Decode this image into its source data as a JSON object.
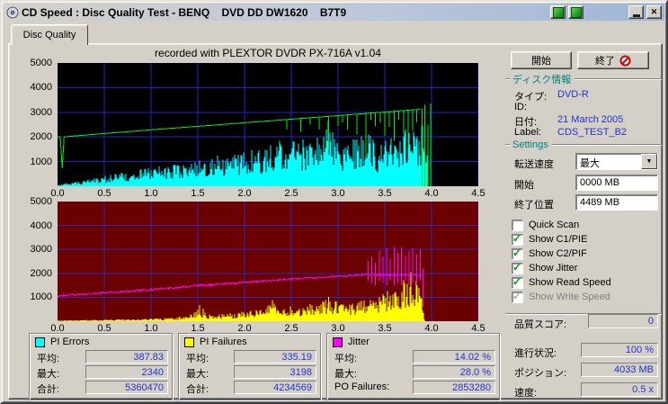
{
  "window": {
    "title": "CD Speed : Disc Quality Test - BENQ    DVD DD DW1620    B7T9"
  },
  "tab": {
    "label": "Disc Quality"
  },
  "recorded_note": "recorded with PLEXTOR DVDR   PX-716A   v1.04",
  "buttons": {
    "start": "開始",
    "exit": "終了"
  },
  "disc_info": {
    "header": "ディスク情報",
    "type_label": "タイプ:",
    "type_value": "DVD-R",
    "id_label": "ID:",
    "id_value": "",
    "date_label": "日付:",
    "date_value": "21 March 2005",
    "label_label": "Label:",
    "label_value": "CDS_TEST_B2"
  },
  "settings": {
    "header": "Settings",
    "speed_label": "転送速度",
    "speed_value": "最大",
    "start_label": "開始",
    "start_value": "0000 MB",
    "end_label": "終了位置",
    "end_value": "4489 MB",
    "checkboxes": [
      {
        "label": "Quick Scan",
        "checked": false,
        "disabled": false
      },
      {
        "label": "Show C1/PIE",
        "checked": true,
        "disabled": false
      },
      {
        "label": "Show C2/PIF",
        "checked": true,
        "disabled": false
      },
      {
        "label": "Show Jitter",
        "checked": true,
        "disabled": false
      },
      {
        "label": "Show Read Speed",
        "checked": true,
        "disabled": false
      },
      {
        "label": "Show Write Speed",
        "checked": true,
        "disabled": true
      }
    ]
  },
  "quality": {
    "label": "品質スコア:",
    "value": "0"
  },
  "progress": {
    "label": "進行状況:",
    "value": "100 %"
  },
  "position": {
    "label": "ポジション:",
    "value": "4033 MB"
  },
  "speed": {
    "label": "速度:",
    "value": "0.5 x"
  },
  "stat_panels": [
    {
      "title": "PI Errors",
      "color": "#00ffff",
      "rows": [
        {
          "label": "平均:",
          "value": "387.83"
        },
        {
          "label": "最大:",
          "value": "2340"
        },
        {
          "label": "合計:",
          "value": "5360470"
        }
      ]
    },
    {
      "title": "PI Failures",
      "color": "#ffff00",
      "rows": [
        {
          "label": "平均:",
          "value": "335.19"
        },
        {
          "label": "最大:",
          "value": "3198"
        },
        {
          "label": "合計:",
          "value": "4234569"
        }
      ]
    },
    {
      "title": "Jitter",
      "color": "#ff00ff",
      "rows": [
        {
          "label": "平均:",
          "value": "14.02 %"
        },
        {
          "label": "最大:",
          "value": "28.0 %"
        },
        {
          "label": "PO Failures:",
          "value": "2853280"
        }
      ]
    }
  ],
  "colors": {
    "face": "#d4d0c8",
    "value_text": "#2233cc",
    "section_header": "#008080"
  },
  "chart_data": [
    {
      "name": "pi-errors-read-speed-chart",
      "type": "area",
      "title": "",
      "xlabel": "",
      "ylabel": "",
      "xlim": [
        0,
        4.5
      ],
      "ylim": [
        0,
        5000
      ],
      "xticks": [
        "0.0",
        "0.5",
        "1.0",
        "1.5",
        "2.0",
        "2.5",
        "3.0",
        "3.5",
        "4.0",
        "4.5"
      ],
      "yticks": [
        1000,
        2000,
        3000,
        4000,
        5000
      ],
      "bg": "#000000",
      "grid_color": "#2222cc",
      "series": [
        {
          "name": "PI Errors",
          "type": "spikes",
          "color": "#00ffff",
          "seed": 7,
          "envelope": [
            [
              0,
              40
            ],
            [
              0.1,
              130
            ],
            [
              0.2,
              190
            ],
            [
              0.3,
              260
            ],
            [
              0.4,
              340
            ],
            [
              0.5,
              420
            ],
            [
              0.6,
              500
            ],
            [
              0.7,
              560
            ],
            [
              0.8,
              620
            ],
            [
              0.9,
              700
            ],
            [
              1.0,
              800
            ],
            [
              1.1,
              860
            ],
            [
              1.2,
              920
            ],
            [
              1.3,
              1000
            ],
            [
              1.4,
              1030
            ],
            [
              1.5,
              1100
            ],
            [
              1.6,
              1200
            ],
            [
              1.7,
              1260
            ],
            [
              1.8,
              1330
            ],
            [
              1.9,
              1420
            ],
            [
              2.0,
              1500
            ],
            [
              2.1,
              1530
            ],
            [
              2.2,
              1620
            ],
            [
              2.3,
              1900
            ],
            [
              2.4,
              1820
            ],
            [
              2.5,
              1900
            ],
            [
              2.6,
              2000
            ],
            [
              2.7,
              1930
            ],
            [
              2.8,
              2050
            ],
            [
              2.9,
              2700
            ],
            [
              3.0,
              2050
            ],
            [
              3.1,
              1850
            ],
            [
              3.2,
              1950
            ],
            [
              3.3,
              2400
            ],
            [
              3.4,
              1780
            ],
            [
              3.5,
              1860
            ],
            [
              3.6,
              2060
            ],
            [
              3.7,
              2260
            ],
            [
              3.8,
              2600
            ],
            [
              3.9,
              2700
            ],
            [
              3.95,
              1400
            ],
            [
              3.97,
              0
            ],
            [
              4.5,
              0
            ]
          ]
        },
        {
          "name": "Read Speed",
          "type": "line",
          "color": "#00ee00",
          "points": [
            [
              0,
              1995
            ],
            [
              0.03,
              2005
            ],
            [
              0.05,
              730
            ],
            [
              0.07,
              2005
            ],
            [
              0.5,
              2140
            ],
            [
              1.0,
              2290
            ],
            [
              1.5,
              2430
            ],
            [
              2.0,
              2575
            ],
            [
              2.5,
              2720
            ],
            [
              3.0,
              2865
            ],
            [
              3.5,
              3010
            ],
            [
              3.88,
              3120
            ]
          ]
        },
        {
          "name": "Read Speed dips",
          "type": "vlines",
          "color": "#00ee00",
          "lines": [
            [
              2.45,
              2300,
              2705
            ],
            [
              2.6,
              2200,
              2750
            ],
            [
              2.7,
              2500,
              2780
            ],
            [
              2.8,
              2300,
              2805
            ],
            [
              2.9,
              1500,
              2835
            ],
            [
              3.0,
              2450,
              2865
            ],
            [
              3.05,
              2600,
              2880
            ],
            [
              3.1,
              2300,
              2895
            ],
            [
              3.2,
              2100,
              2920
            ],
            [
              3.3,
              1250,
              2950
            ],
            [
              3.35,
              2700,
              2965
            ],
            [
              3.4,
              2450,
              2980
            ],
            [
              3.45,
              2600,
              2995
            ],
            [
              3.5,
              2050,
              3010
            ],
            [
              3.55,
              2400,
              3025
            ],
            [
              3.6,
              1850,
              3040
            ],
            [
              3.65,
              2700,
              3050
            ],
            [
              3.7,
              2150,
              3065
            ],
            [
              3.75,
              1550,
              3080
            ],
            [
              3.8,
              2250,
              3095
            ],
            [
              3.84,
              2600,
              3105
            ]
          ]
        },
        {
          "name": "Read Speed end spikes",
          "type": "vlines",
          "color": "#00ee00",
          "lines": [
            [
              3.9,
              0,
              3150
            ],
            [
              3.93,
              0,
              3300
            ],
            [
              3.96,
              0,
              2500
            ],
            [
              3.99,
              0,
              3350
            ]
          ]
        }
      ]
    },
    {
      "name": "pi-failures-jitter-chart",
      "type": "area",
      "title": "",
      "xlabel": "",
      "ylabel": "",
      "xlim": [
        0,
        4.5
      ],
      "ylim": [
        0,
        5000
      ],
      "xticks": [
        "0.0",
        "0.5",
        "1.0",
        "1.5",
        "2.0",
        "2.5",
        "3.0",
        "3.5",
        "4.0",
        "4.5"
      ],
      "yticks": [
        1000,
        2000,
        3000,
        4000,
        5000
      ],
      "bg": "#6b0000",
      "grid_color": "#2a2ab8",
      "series": [
        {
          "name": "PI Failures",
          "type": "spikes",
          "color": "#ffff00",
          "seed": 3,
          "envelope": [
            [
              0,
              30
            ],
            [
              0.2,
              45
            ],
            [
              0.4,
              60
            ],
            [
              0.6,
              75
            ],
            [
              0.8,
              95
            ],
            [
              1.0,
              120
            ],
            [
              1.2,
              150
            ],
            [
              1.4,
              220
            ],
            [
              1.5,
              600
            ],
            [
              1.6,
              320
            ],
            [
              1.8,
              330
            ],
            [
              2.0,
              420
            ],
            [
              2.2,
              520
            ],
            [
              2.3,
              900
            ],
            [
              2.4,
              620
            ],
            [
              2.5,
              700
            ],
            [
              2.6,
              660
            ],
            [
              2.7,
              720
            ],
            [
              2.8,
              760
            ],
            [
              2.9,
              1000
            ],
            [
              3.0,
              820
            ],
            [
              3.1,
              780
            ],
            [
              3.2,
              820
            ],
            [
              3.3,
              920
            ],
            [
              3.4,
              1020
            ],
            [
              3.5,
              1400
            ],
            [
              3.6,
              1150
            ],
            [
              3.7,
              1800
            ],
            [
              3.8,
              2000
            ],
            [
              3.85,
              1600
            ],
            [
              3.9,
              900
            ],
            [
              3.93,
              0
            ],
            [
              4.5,
              0
            ]
          ]
        },
        {
          "name": "PI Failures tall spikes",
          "type": "vlines",
          "color": "#ffff00",
          "lines": [
            [
              1.52,
              0,
              680
            ],
            [
              1.56,
              0,
              520
            ],
            [
              2.3,
              0,
              880
            ],
            [
              2.33,
              0,
              620
            ],
            [
              2.9,
              0,
              1020
            ],
            [
              3.78,
              0,
              2050
            ]
          ]
        },
        {
          "name": "Jitter",
          "type": "noise-line",
          "color": "#ff00ff",
          "noise": 90,
          "xend": 3.9,
          "points": [
            [
              0,
              1060
            ],
            [
              0.5,
              1180
            ],
            [
              1.0,
              1320
            ],
            [
              1.5,
              1480
            ],
            [
              2.0,
              1620
            ],
            [
              2.5,
              1760
            ],
            [
              3.0,
              1880
            ],
            [
              3.3,
              1950
            ],
            [
              3.9,
              1920
            ]
          ]
        },
        {
          "name": "Jitter spikes",
          "type": "vlines",
          "color": "#ff00ff",
          "lines": [
            [
              3.32,
              1700,
              2500
            ],
            [
              3.36,
              1600,
              2700
            ],
            [
              3.4,
              1500,
              2450
            ],
            [
              3.44,
              1700,
              2950
            ],
            [
              3.48,
              1600,
              2700
            ],
            [
              3.52,
              1500,
              3050
            ],
            [
              3.56,
              1700,
              2600
            ],
            [
              3.6,
              1500,
              3100
            ],
            [
              3.64,
              1600,
              2850
            ],
            [
              3.68,
              1500,
              3100
            ],
            [
              3.72,
              1700,
              2700
            ],
            [
              3.76,
              1500,
              2950
            ],
            [
              3.8,
              1600,
              3050
            ],
            [
              3.84,
              1500,
              2800
            ],
            [
              3.88,
              1700,
              3000
            ],
            [
              3.91,
              600,
              2200
            ]
          ]
        }
      ]
    }
  ]
}
